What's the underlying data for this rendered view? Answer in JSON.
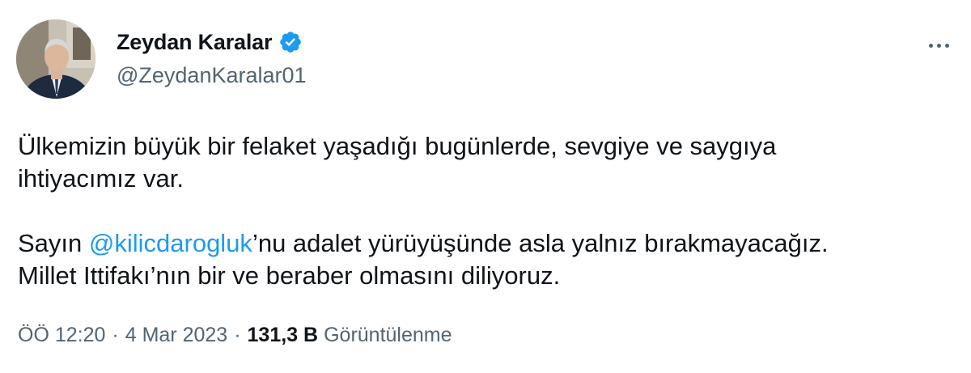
{
  "author": {
    "display_name": "Zeydan Karalar",
    "handle": "@ZeydanKaralar01",
    "verified": true
  },
  "tweet": {
    "line1": "Ülkemizin büyük bir felaket yaşadığı bugünlerde, sevgiye ve saygıya",
    "line2": "ihtiyacımız var.",
    "line3_prefix": "Sayın ",
    "mention": "@kilicdarogluk",
    "line3_suffix": "’nu adalet yürüyüşünde asla yalnız bırakmayacağız.",
    "line4": "Millet Ittifakı’nın bir ve beraber olmasını diliyoruz."
  },
  "meta": {
    "time": "ÖÖ 12:20",
    "separator": "·",
    "date": "4 Mar 2023",
    "views_count": "131,3 B",
    "views_label": "Görüntülenme"
  },
  "icons": {
    "verified": "verified-badge-icon",
    "more": "more-horizontal-icon"
  },
  "colors": {
    "accent": "#1d9bf0",
    "text": "#0f1419",
    "muted": "#536471"
  }
}
